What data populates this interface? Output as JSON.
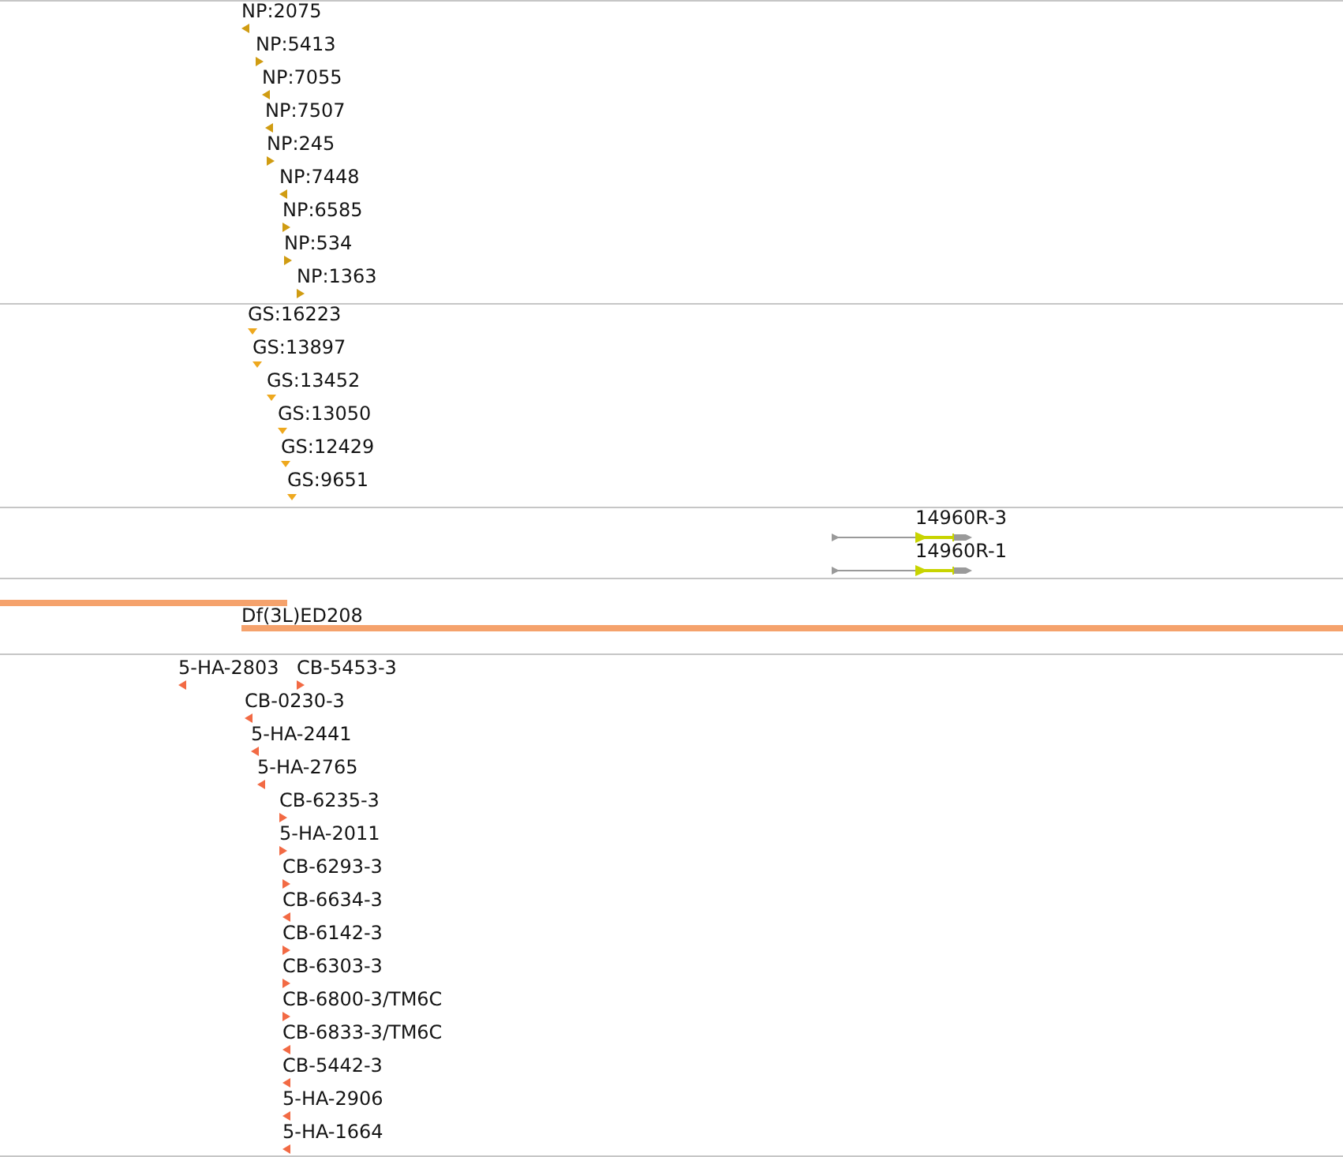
{
  "tracks": [
    {
      "kind": "stranded",
      "color": "#d09c12",
      "features": [
        {
          "label": "NP:2075",
          "reverse": true
        },
        {
          "label": "NP:5413",
          "reverse": false
        },
        {
          "label": "NP:7055",
          "reverse": true
        },
        {
          "label": "NP:7507",
          "reverse": true
        },
        {
          "label": "NP:245",
          "reverse": false
        },
        {
          "label": "NP:7448",
          "reverse": true
        },
        {
          "label": "NP:6585",
          "reverse": false
        },
        {
          "label": "NP:534",
          "reverse": false
        },
        {
          "label": "NP:1363",
          "reverse": false
        }
      ]
    },
    {
      "kind": "points",
      "color": "#eea81e",
      "features": [
        {
          "label": "GS:16223"
        },
        {
          "label": "GS:13897"
        },
        {
          "label": "GS:13452"
        },
        {
          "label": "GS:13050"
        },
        {
          "label": "GS:12429"
        },
        {
          "label": "GS:9651"
        }
      ]
    },
    {
      "kind": "transcripts",
      "features": [
        {
          "label": "14960R-3",
          "reverse": false
        },
        {
          "label": "14960R-1",
          "reverse": false
        }
      ]
    },
    {
      "kind": "bars",
      "color": "#f5a26c",
      "features": [
        {
          "clipped": true
        },
        {
          "label": "Df(3L)ED208",
          "clipped": false
        }
      ]
    },
    {
      "kind": "stranded",
      "color": "#f26a44",
      "features": [
        {
          "label": "5-HA-2803",
          "reverse": true
        },
        {
          "label": "CB-5453-3",
          "reverse": false
        },
        {
          "label": "CB-0230-3",
          "reverse": true
        },
        {
          "label": "5-HA-2441",
          "reverse": true
        },
        {
          "label": "5-HA-2765",
          "reverse": true
        },
        {
          "label": "CB-6235-3",
          "reverse": false
        },
        {
          "label": "5-HA-2011",
          "reverse": false
        },
        {
          "label": "CB-6293-3",
          "reverse": false
        },
        {
          "label": "CB-6634-3",
          "reverse": true
        },
        {
          "label": "CB-6142-3",
          "reverse": false
        },
        {
          "label": "CB-6303-3",
          "reverse": false
        },
        {
          "label": "CB-6800-3/TM6C",
          "reverse": false
        },
        {
          "label": "CB-6833-3/TM6C",
          "reverse": true
        },
        {
          "label": "CB-5442-3",
          "reverse": true
        },
        {
          "label": "5-HA-2906",
          "reverse": true
        },
        {
          "label": "5-HA-1664",
          "reverse": true
        }
      ]
    }
  ]
}
